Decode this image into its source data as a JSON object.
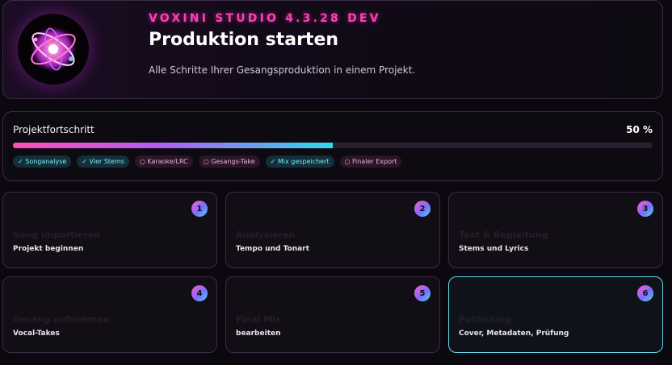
{
  "header": {
    "app_version": "VOXINI STUDIO 4.3.28 DEV",
    "title": "Produktion starten",
    "subtitle": "Alle Schritte Ihrer Gesangsproduktion in einem Projekt."
  },
  "progress": {
    "label": "Projektfortschritt",
    "percent_text": "50 %",
    "fraction": 0.5,
    "chips": [
      {
        "label": "✓ Songanalyse",
        "done": true
      },
      {
        "label": "✓ Vier Stems",
        "done": true
      },
      {
        "label": "○ Karaoke/LRC",
        "done": false
      },
      {
        "label": "○ Gesangs-Take",
        "done": false
      },
      {
        "label": "✓ Mix gespeichert",
        "done": true
      },
      {
        "label": "○ Finaler Export",
        "done": false
      }
    ]
  },
  "steps": [
    {
      "num": "1",
      "title": "Song importieren",
      "subtitle": "Projekt beginnen"
    },
    {
      "num": "2",
      "title": "Analysieren",
      "subtitle": "Tempo und Tonart"
    },
    {
      "num": "3",
      "title": "Text & Begleitung",
      "subtitle": "Stems und Lyrics"
    },
    {
      "num": "4",
      "title": "Gesang aufnehmen",
      "subtitle": "Vocal-Takes"
    },
    {
      "num": "5",
      "title": "Final Mix",
      "subtitle": "bearbeiten"
    },
    {
      "num": "6",
      "title": "Publishing",
      "subtitle": "Cover, Metadaten, Prüfung"
    }
  ],
  "colors": {
    "accent_pink": "#ff3fb8",
    "accent_cyan": "#2fd8f0",
    "active_border": "#5fd7e8"
  }
}
